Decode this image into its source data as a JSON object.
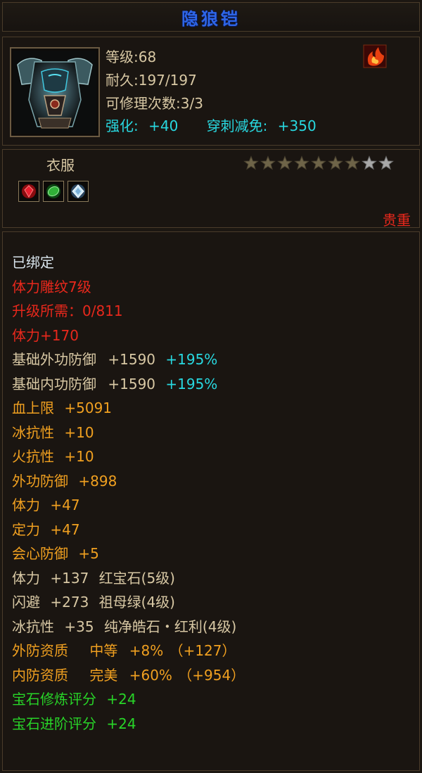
{
  "item": {
    "name": "隐狼铠",
    "level_line": "等级:68",
    "durability_line": "耐久:197/197",
    "repair_line": "可修理次数:3/3",
    "enhance_label": "强化:",
    "enhance_value": "+40",
    "pierce_label": "穿刺减免:",
    "pierce_value": "+350",
    "slot_type": "衣服",
    "rarity": "贵重",
    "stars_total": 9,
    "stars_filled": 7,
    "icons": {
      "item_icon": "armor-chestplate-icon",
      "badge": "flame-badge-icon",
      "gems": [
        "ruby-gem-icon",
        "emerald-gem-icon",
        "diamond-gem-icon"
      ]
    },
    "colors": {
      "title": "#2e66e8",
      "red": "#e8281c",
      "cyan": "#28d8e0",
      "orange": "#f0a020",
      "green": "#28d428",
      "tan": "#d8c8a4"
    }
  },
  "attributes": {
    "bound": "已绑定",
    "engrave": "体力雕纹7级",
    "upgrade": "升级所需：0/811",
    "stamina_bonus": "体力+170",
    "base_outer_def": {
      "label": "基础外功防御",
      "value": "+1590",
      "pct": "+195%"
    },
    "base_inner_def": {
      "label": "基础内功防御",
      "value": "+1590",
      "pct": "+195%"
    },
    "hp_max": {
      "label": "血上限",
      "value": "+5091"
    },
    "ice_res": {
      "label": "冰抗性",
      "value": "+10"
    },
    "fire_res": {
      "label": "火抗性",
      "value": "+10"
    },
    "outer_def": {
      "label": "外功防御",
      "value": "+898"
    },
    "stamina": {
      "label": "体力",
      "value": "+47"
    },
    "focus": {
      "label": "定力",
      "value": "+47"
    },
    "crit_def": {
      "label": "会心防御",
      "value": "+5"
    },
    "gem1": {
      "label": "体力",
      "value": "+137",
      "gem": "红宝石(5级)"
    },
    "gem2": {
      "label": "闪避",
      "value": "+273",
      "gem": "祖母绿(4级)"
    },
    "gem3": {
      "label": "冰抗性",
      "value": "+35",
      "gem": "纯净皓石・红利(4级)"
    },
    "outer_quality": {
      "label": "外防资质",
      "grade": "中等",
      "pct": "+8%",
      "extra": "（+127）"
    },
    "inner_quality": {
      "label": "内防资质",
      "grade": "完美",
      "pct": "+60%",
      "extra": "（+954）"
    },
    "gem_refine": {
      "label": "宝石修炼评分",
      "value": "+24"
    },
    "gem_advance": {
      "label": "宝石进阶评分",
      "value": "+24"
    }
  }
}
